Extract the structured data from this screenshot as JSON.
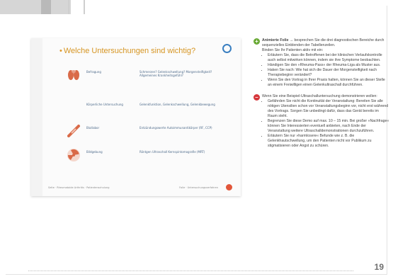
{
  "slide": {
    "title": "Welche Untersuchungen sind wichtig?",
    "rows": [
      {
        "icon": "joint-icon",
        "label": "Befragung",
        "desc": "Schmerzen? Gelenkschwellung? Morgensteifigkeit? Allgemeines Krankheitsgefühl?"
      },
      {
        "icon": "hand-icon",
        "label": "Körperliche Untersuchung",
        "desc": "Gelenkfunktion, Gelenkschwellung, Gelenkbewegung"
      },
      {
        "icon": "syringe-icon",
        "label": "Blutlabor",
        "desc": "Entzündungswerte Autoimmunantikörper (RF, CCP)"
      },
      {
        "icon": "radiation-icon",
        "label": "Bildgebung",
        "desc": "Röntgen Ultraschall Kernspintomografie (MRT)"
      }
    ],
    "footer_left": "Seite · Rheumatoide Arthritis · Patientenschulung",
    "footer_right": "Folie · Untersuchungsverfahren"
  },
  "notes": {
    "block1": {
      "lead_bold": "Animierte Folie →",
      "lead_text": " besprechen Sie die drei diagnostischen Bereiche durch sequenzielles Einblenden der Tabellenzeilen.",
      "intro": "Binden Sie Ihr Patienten aktiv mit ein:",
      "bullets": [
        "Erläutern Sie, dass die Betroffenen bei der klinischen Verlaufskontrolle auch selbst mitwirken können, indem sie ihre Symptome beobachten.",
        "Händigen Sie den »Rheuma-Pass« der Rheuma-Liga als Muster aus.",
        "Haken Sie nach: Wie hat sich die Dauer der Morgensteifigkeit nach Therapiebeginn verändert?",
        "Wenn Sie den Vortrag in Ihrer Praxis halten, können Sie an dieser Stelle an einem Freiwilligen einen Gelenkultraschall durchführen."
      ]
    },
    "block2": {
      "lead": "Wenn Sie eine Beispiel-Ultraschalluntersuchung demonstrieren wollen:",
      "bullets": [
        "Gefährden Sie nicht die Kontinuität der Veranstaltung: Bereiten Sie alle nötigen Utensilien schon vor Veranstaltungsbeginn vor, nicht erst während des Vortrags. Sorgen Sie unbedingt dafür, dass das Gerät bereits im Raum steht.",
        "Begrenzen Sie diese Demo auf max. 10 – 15 min. Bei großer »Nachfrage« können Sie Interessierten eventuell anbieten, nach Ende der Veranstaltung weitere Ultraschalldemonstrationen durchzuführen.",
        "Erläutern Sie nur »harmlosere« Befunde wie z. B. die Gelenkhautschwellung, um den Patienten nicht vor Publikum zu stigmatisieren oder Angst zu schüren."
      ]
    }
  },
  "page_number": "19"
}
